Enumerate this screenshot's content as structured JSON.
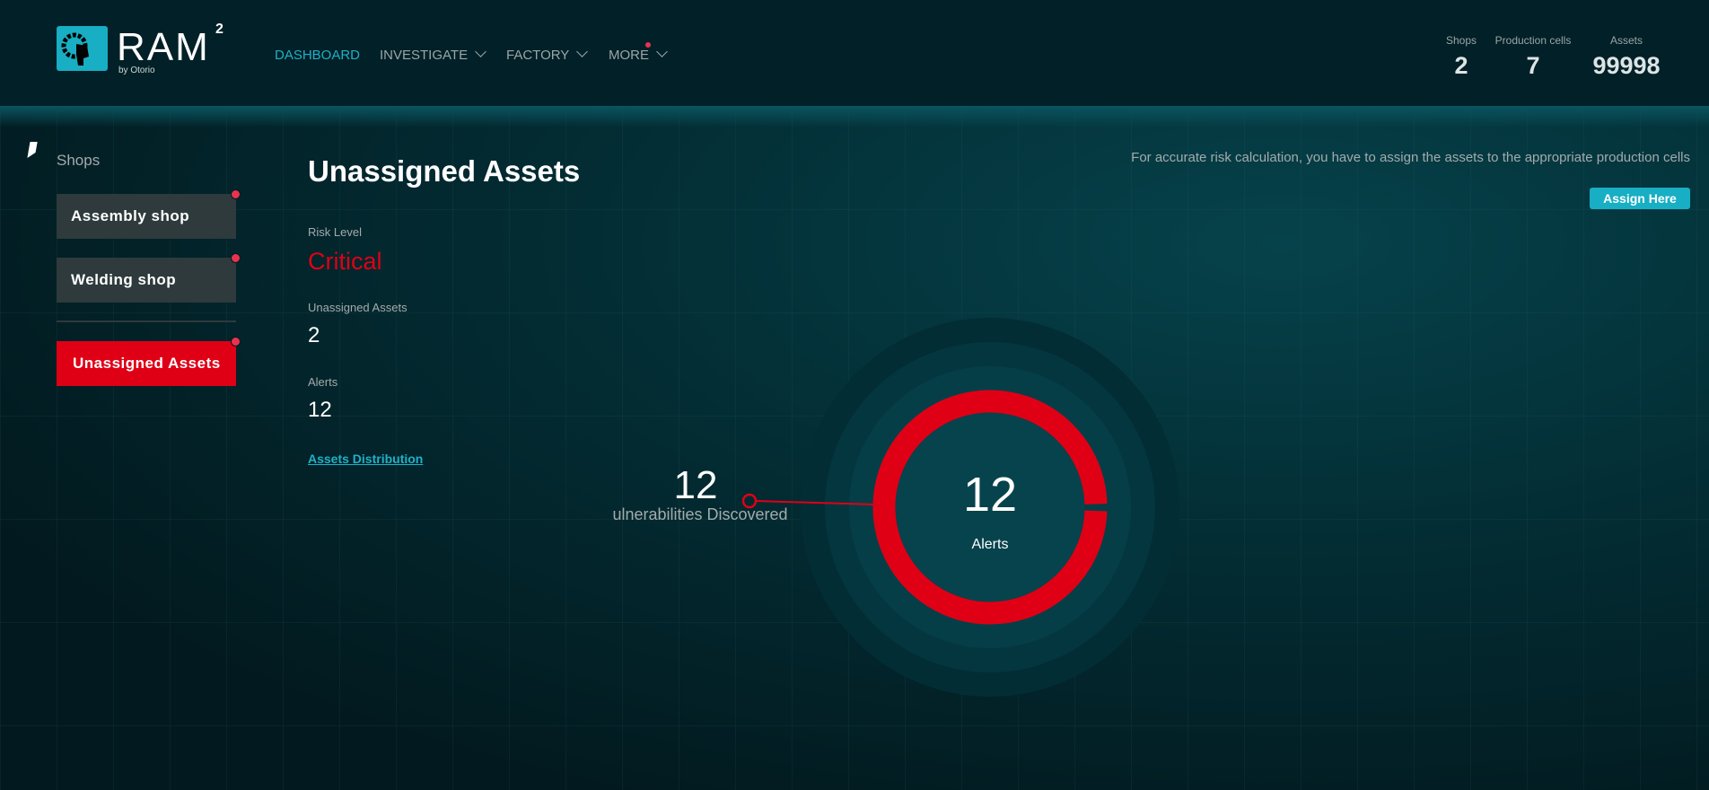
{
  "header": {
    "logo_text": "RAM",
    "logo_sup": "2",
    "logo_by": "by Otorio",
    "nav": [
      {
        "label": "DASHBOARD",
        "active": true
      },
      {
        "label": "INVESTIGATE"
      },
      {
        "label": "FACTORY"
      },
      {
        "label": "MORE",
        "badge": true
      }
    ],
    "stats": [
      {
        "label": "Shops",
        "value": "2"
      },
      {
        "label": "Production cells",
        "value": "7"
      },
      {
        "label": "Assets",
        "value": "99998"
      }
    ]
  },
  "sidebar": {
    "title": "Shops",
    "items": [
      {
        "label": "Assembly shop"
      },
      {
        "label": "Welding shop"
      },
      {
        "label": "Unassigned Assets",
        "active": true
      }
    ]
  },
  "main": {
    "title": "Unassigned Assets",
    "risk_label": "Risk Level",
    "risk_value": "Critical",
    "unassigned_label": "Unassigned Assets",
    "unassigned_value": "2",
    "alerts_label": "Alerts",
    "alerts_value": "12",
    "link": "Assets Distribution",
    "info": "For accurate risk calculation, you have to assign the assets to the appropriate production cells",
    "assign_button": "Assign Here"
  },
  "chart": {
    "center_value": "12",
    "center_label": "Alerts",
    "side_value": "12",
    "side_label": "ulnerabilities Discovered",
    "ring_color": "#df0016"
  },
  "colors": {
    "accent": "#1fb1c8",
    "critical": "#df0016",
    "badge": "#e8334f"
  }
}
